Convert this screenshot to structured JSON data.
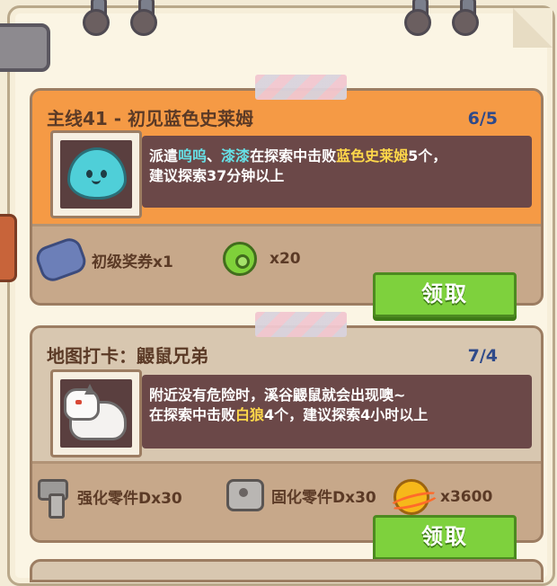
{
  "quests": [
    {
      "title": "主线41 - 初见蓝色史莱姆",
      "progress": "6/5",
      "desc": {
        "prefix": "派遣",
        "hero1": "呜呜",
        "sep": "、",
        "hero2": "漆漆",
        "mid": "在探索中击败",
        "target": "蓝色史莱姆",
        "tail": "5个，",
        "line2": "建议探索37分钟以上"
      },
      "portrait_icon": "blue-slime",
      "rewards": [
        {
          "icon": "ticket-icon",
          "label": "初级奖券x1"
        },
        {
          "icon": "green-donut-icon",
          "label": "x20"
        }
      ],
      "claim_label": "领取"
    },
    {
      "title": "地图打卡：鼹鼠兄弟",
      "progress": "7/4",
      "desc": {
        "line1": "附近没有危险时，溪谷鼹鼠就会出现噢~",
        "pre": "在探索中击败",
        "target": "白狼",
        "tail": "4个，建议探索4小时以上"
      },
      "portrait_icon": "white-wolf",
      "rewards": [
        {
          "icon": "bolt-icon",
          "label": "强化零件Dx30"
        },
        {
          "icon": "nut-icon",
          "label": "固化零件Dx30"
        },
        {
          "icon": "gold-coin-icon",
          "label": "x3600"
        }
      ],
      "claim_label": "领取"
    }
  ],
  "colors": {
    "main_header": "#f59a45",
    "map_header": "#d8c7b0",
    "claim_button": "#7ed13d",
    "progress_text": "#2f4a8a",
    "highlight_cyan": "#66e0e6",
    "highlight_yellow": "#ffd84a"
  }
}
